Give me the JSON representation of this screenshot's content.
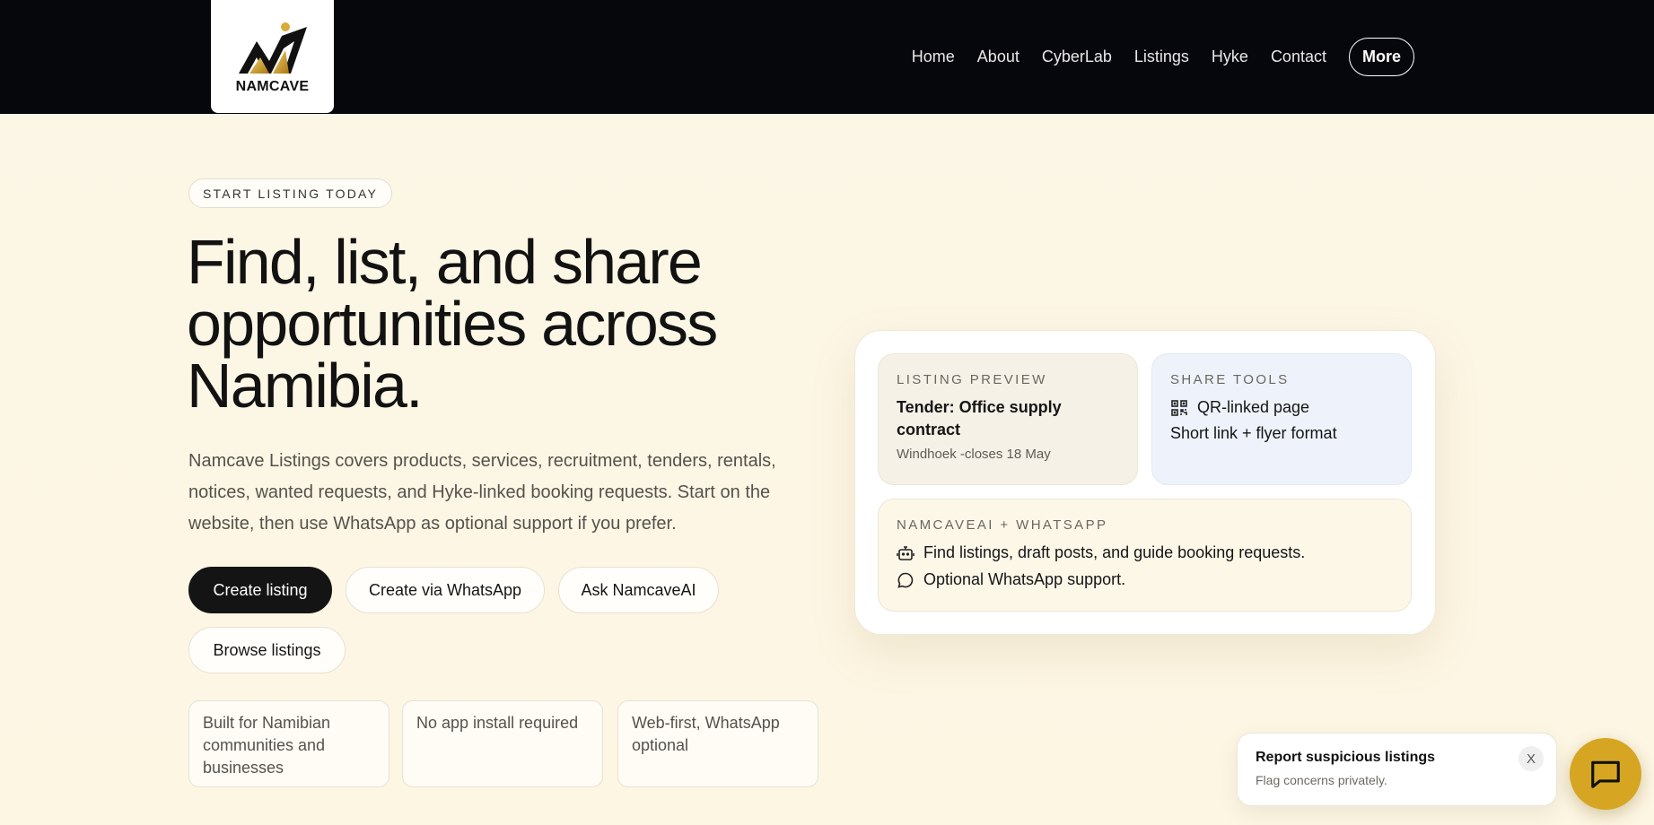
{
  "header": {
    "logo_text": "NAMCAVE",
    "nav": [
      {
        "label": "Home"
      },
      {
        "label": "About"
      },
      {
        "label": "CyberLab"
      },
      {
        "label": "Listings"
      },
      {
        "label": "Hyke"
      },
      {
        "label": "Contact"
      }
    ],
    "more_label": "More"
  },
  "hero": {
    "tag": "START LISTING TODAY",
    "title_line1": "Find, list, and share",
    "title_line2": "opportunities across",
    "title_line3": "Namibia.",
    "description": "Namcave Listings covers products, services, recruitment, tenders, rentals, notices, wanted requests, and Hyke-linked booking requests. Start on the website, then use WhatsApp as optional support if you prefer.",
    "buttons": {
      "create_listing": "Create listing",
      "create_whatsapp": "Create via WhatsApp",
      "ask_ai": "Ask NamcaveAI",
      "browse": "Browse listings"
    },
    "features": [
      "Built for Namibian communities and businesses",
      "No app install required",
      "Web-first, WhatsApp optional"
    ]
  },
  "panel": {
    "preview": {
      "label": "LISTING PREVIEW",
      "title": "Tender: Office supply contract",
      "meta": "Windhoek -closes 18 May"
    },
    "share": {
      "label": "SHARE TOOLS",
      "item1": "QR-linked page",
      "item2": "Short link + flyer format"
    },
    "whatsapp": {
      "label": "NAMCAVEAI + WHATSAPP",
      "item1": "Find listings, draft posts, and guide booking requests.",
      "item2": "Optional WhatsApp support."
    }
  },
  "toast": {
    "title": "Report suspicious listings",
    "subtitle": "Flag concerns privately.",
    "close": "X"
  },
  "colors": {
    "header_bg": "#06070d",
    "page_bg": "#fcf6e6",
    "primary_button": "#141414",
    "accent_gold": "#d6a622",
    "share_bg": "#eef3fb"
  },
  "icons": {
    "logo": "namcave-logo",
    "qr": "qr-code-icon",
    "bot": "bot-icon",
    "chat": "chat-bubble-icon",
    "fab": "message-square-icon"
  }
}
